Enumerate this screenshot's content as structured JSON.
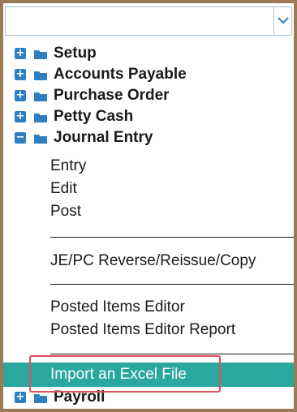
{
  "dropdown": {
    "value": "",
    "icon": "chevron-down-icon"
  },
  "tree": {
    "nodes": [
      {
        "label": "Setup",
        "expander": "+",
        "icon": "folder-icon"
      },
      {
        "label": "Accounts Payable",
        "expander": "+",
        "icon": "folder-icon"
      },
      {
        "label": "Purchase Order",
        "expander": "+",
        "icon": "folder-icon"
      },
      {
        "label": "Petty Cash",
        "expander": "+",
        "icon": "folder-icon"
      },
      {
        "label": "Journal Entry",
        "expander": "−",
        "icon": "folder-icon"
      }
    ],
    "journal_entry_items": {
      "group1": [
        "Entry",
        "Edit",
        "Post"
      ],
      "group2": [
        "JE/PC Reverse/Reissue/Copy"
      ],
      "group3": [
        "Posted Items Editor",
        "Posted Items Editor Report"
      ],
      "selected": "Import an Excel File"
    },
    "partial_node": {
      "label": "Payroll",
      "expander": "+",
      "icon": "folder-icon"
    }
  },
  "colors": {
    "accent": "#2e7fc1",
    "selected_row": "#2aa79f",
    "callout": "#e0505a",
    "frame": "#9b7a55"
  }
}
